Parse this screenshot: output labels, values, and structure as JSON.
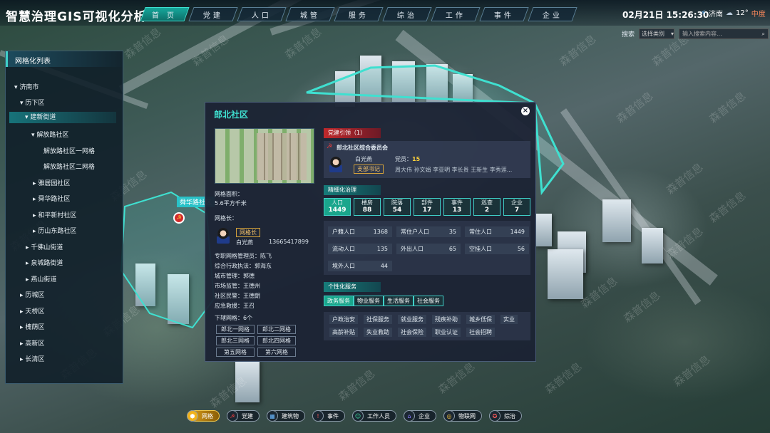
{
  "app_title": "智慧治理GIS可视化分析",
  "nav_tabs": [
    "首 页",
    "党建",
    "人口",
    "城管",
    "服务",
    "综治",
    "工作",
    "事件",
    "企业"
  ],
  "datetime": "02月21日 15:26:30",
  "weather": {
    "city": "济南",
    "temp": "12°",
    "aqi": "中度"
  },
  "search": {
    "label": "搜索",
    "select": "选择类别",
    "placeholder": "输入搜索内容..."
  },
  "tree": {
    "title": "网格化列表",
    "items": [
      "济南市",
      "历下区",
      "建新街道",
      "解放路社区",
      "解放路社区一网格",
      "解放路社区二网格",
      "雅居园社区",
      "舜华路社区",
      "和平新村社区",
      "历山东路社区",
      "千佛山街道",
      "泉城路街道",
      "燕山街道",
      "历城区",
      "天桥区",
      "槐荫区",
      "高新区",
      "长清区"
    ]
  },
  "map": {
    "label": "舜华路社区"
  },
  "popup": {
    "title": "郎北社区",
    "area_label": "网格面积：",
    "area_value": "5.6平方千米",
    "leader_label": "网格长：",
    "leader_tag": "网格长",
    "leader_name": "白光燕",
    "leader_phone": "13665417899",
    "staff": [
      {
        "label": "专职网格管理员：",
        "value": "陈飞"
      },
      {
        "label": "综合行政执法：",
        "value": "郭海东"
      },
      {
        "label": "城市管理：",
        "value": "郭德"
      },
      {
        "label": "市场监管：",
        "value": "王德州"
      },
      {
        "label": "社区民警：",
        "value": "王德朗"
      },
      {
        "label": "应急救援：",
        "value": "王召"
      }
    ],
    "sub_grids_label": "下辖网格：",
    "sub_grids_count": "6个",
    "sub_grids": [
      "郎北一网格",
      "郎北二网格",
      "郎北三网格",
      "郎北四网格",
      "第五网格",
      "第六网格"
    ],
    "party": {
      "section": "党建引领（1）",
      "committee": "郎北社区综合委员会",
      "secretary": "白光燕",
      "role": "支部书记",
      "members_label": "党员：",
      "members_count": "15",
      "members": "周大伟 孙文娟 李亚明 李长贵 王新生 李秀莲..."
    },
    "fine": {
      "section": "精细化治理",
      "stats": [
        {
          "label": "人口",
          "value": "1449"
        },
        {
          "label": "楼房",
          "value": "88"
        },
        {
          "label": "院落",
          "value": "54"
        },
        {
          "label": "部件",
          "value": "17"
        },
        {
          "label": "事件",
          "value": "13"
        },
        {
          "label": "巡查",
          "value": "2"
        },
        {
          "label": "企业",
          "value": "7"
        }
      ],
      "population": [
        {
          "label": "户籍人口",
          "value": "1368"
        },
        {
          "label": "常住户人口",
          "value": "35"
        },
        {
          "label": "常住人口",
          "value": "1449"
        },
        {
          "label": "流动人口",
          "value": "135"
        },
        {
          "label": "外出人口",
          "value": "65"
        },
        {
          "label": "空挂人口",
          "value": "56"
        },
        {
          "label": "境外人口",
          "value": "44"
        }
      ]
    },
    "personal": {
      "section": "个性化服务",
      "tabs": [
        "政务服务",
        "物业服务",
        "生活服务",
        "社会服务"
      ],
      "items": [
        "户政治安",
        "社保服务",
        "就业服务",
        "残疾补助",
        "城乡低保",
        "实业",
        "高龄补贴",
        "失业救助",
        "社会保险",
        "职业认证",
        "社会招聘"
      ]
    }
  },
  "bottom_bar": [
    {
      "label": "网格",
      "icon": "⬢"
    },
    {
      "label": "党建",
      "icon": "☭"
    },
    {
      "label": "建筑物",
      "icon": "▦"
    },
    {
      "label": "事件",
      "icon": "!"
    },
    {
      "label": "工作人员",
      "icon": "☺"
    },
    {
      "label": "企业",
      "icon": "⌂"
    },
    {
      "label": "物联网",
      "icon": "◎"
    },
    {
      "label": "综治",
      "icon": "✪"
    }
  ],
  "watermark": "森普信息",
  "colors": {
    "accent": "#3fe0d0",
    "active_nav": "#16a89c",
    "active_bottom": "#e0a21a",
    "party_red": "#c0282b"
  }
}
